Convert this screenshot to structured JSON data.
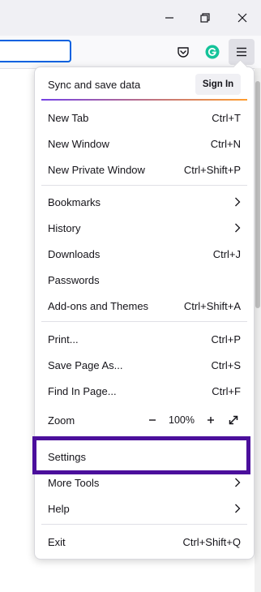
{
  "menu": {
    "sync_label": "Sync and save data",
    "sign_in_label": "Sign In",
    "items": {
      "new_tab": {
        "label": "New Tab",
        "shortcut": "Ctrl+T"
      },
      "new_window": {
        "label": "New Window",
        "shortcut": "Ctrl+N"
      },
      "new_private_window": {
        "label": "New Private Window",
        "shortcut": "Ctrl+Shift+P"
      },
      "bookmarks": {
        "label": "Bookmarks"
      },
      "history": {
        "label": "History"
      },
      "downloads": {
        "label": "Downloads",
        "shortcut": "Ctrl+J"
      },
      "passwords": {
        "label": "Passwords"
      },
      "addons": {
        "label": "Add-ons and Themes",
        "shortcut": "Ctrl+Shift+A"
      },
      "print": {
        "label": "Print...",
        "shortcut": "Ctrl+P"
      },
      "save_page": {
        "label": "Save Page As...",
        "shortcut": "Ctrl+S"
      },
      "find": {
        "label": "Find In Page...",
        "shortcut": "Ctrl+F"
      },
      "zoom": {
        "label": "Zoom",
        "value": "100%"
      },
      "settings": {
        "label": "Settings"
      },
      "more_tools": {
        "label": "More Tools"
      },
      "help": {
        "label": "Help"
      },
      "exit": {
        "label": "Exit",
        "shortcut": "Ctrl+Shift+Q"
      }
    }
  },
  "colors": {
    "highlight_border": "#4b0f9c",
    "grammarly": "#15c39a",
    "urlbar_focus": "#0061e0"
  },
  "icons": [
    "minimize-icon",
    "restore-icon",
    "close-icon",
    "pocket-icon",
    "grammarly-icon",
    "hamburger-menu-icon",
    "chevron-right-icon",
    "zoom-out-icon",
    "zoom-in-icon",
    "fullscreen-icon"
  ]
}
